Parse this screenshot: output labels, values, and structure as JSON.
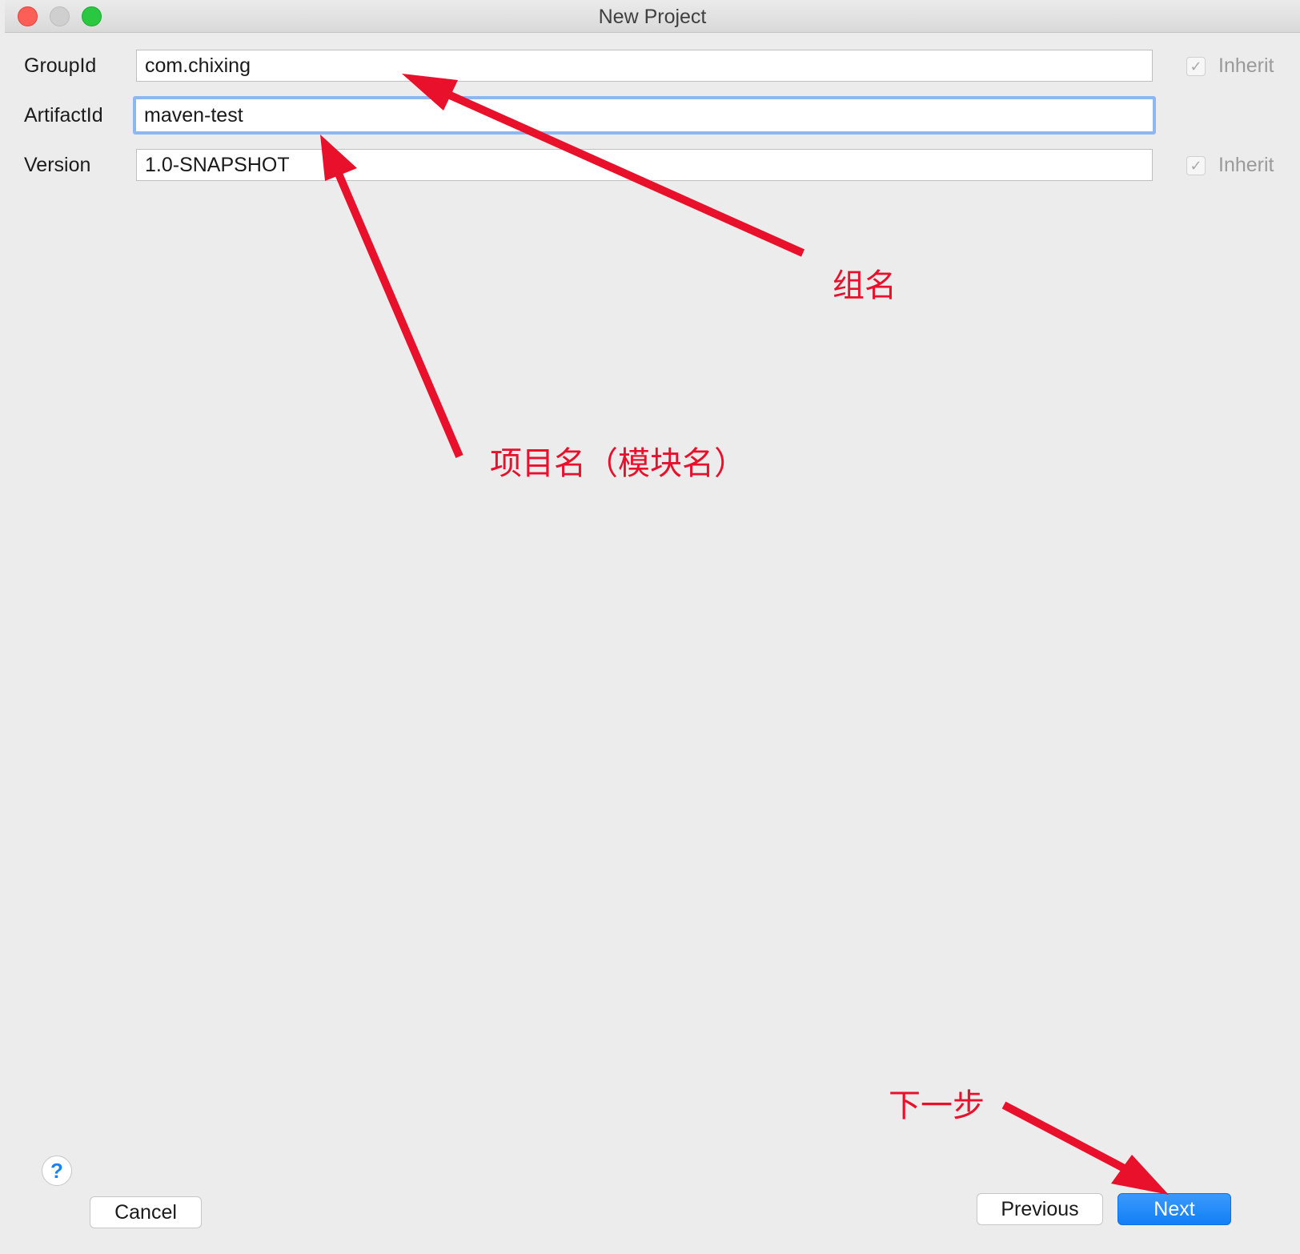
{
  "window": {
    "title": "New Project"
  },
  "form": {
    "group_id": {
      "label": "GroupId",
      "value": "com.chixing",
      "inherit_label": "Inherit",
      "inherit_checked": true
    },
    "artifact_id": {
      "label": "ArtifactId",
      "value": "maven-test"
    },
    "version": {
      "label": "Version",
      "value": "1.0-SNAPSHOT",
      "inherit_label": "Inherit",
      "inherit_checked": true
    }
  },
  "annotations": {
    "group_name": "组名",
    "project_name": "项目名（模块名）",
    "next_step": "下一步"
  },
  "footer": {
    "help_icon": "?",
    "cancel_label": "Cancel",
    "previous_label": "Previous",
    "next_label": "Next"
  },
  "colors": {
    "annotation": "#e8102a",
    "primary_button": "#127ff5",
    "focus_ring": "#8db7f0"
  }
}
